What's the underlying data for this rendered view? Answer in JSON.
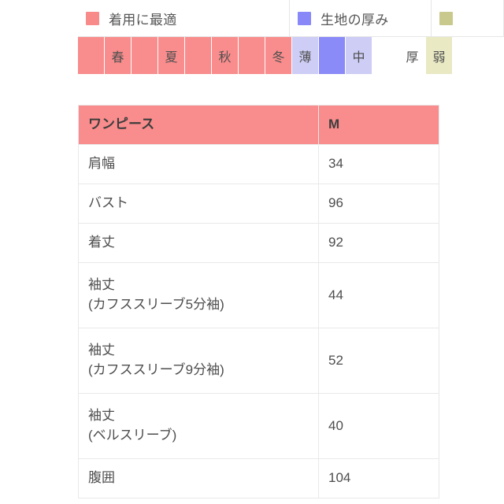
{
  "legend": {
    "items": [
      {
        "key": "season",
        "label": "着用に最適",
        "color": "#F98A8A"
      },
      {
        "key": "thick",
        "label": "生地の厚み",
        "color": "#8888F8"
      },
      {
        "key": "stretch",
        "label": "",
        "color": "#C9C98E"
      }
    ]
  },
  "scale": {
    "cells": [
      {
        "label": "",
        "color": "#F98C8C",
        "group": "season"
      },
      {
        "label": "春",
        "color": "#F98C8C",
        "group": "season"
      },
      {
        "label": "",
        "color": "#F98C8C",
        "group": "season"
      },
      {
        "label": "夏",
        "color": "#F98C8C",
        "group": "season"
      },
      {
        "label": "",
        "color": "#F98C8C",
        "group": "season"
      },
      {
        "label": "秋",
        "color": "#F98C8C",
        "group": "season"
      },
      {
        "label": "",
        "color": "#F98C8C",
        "group": "season"
      },
      {
        "label": "冬",
        "color": "#F98C8C",
        "group": "season"
      },
      {
        "label": "薄",
        "color": "#CDCDF6",
        "group": "thick"
      },
      {
        "label": "",
        "color": "#8A8AF8",
        "group": "thick"
      },
      {
        "label": "中",
        "color": "#CDCDF6",
        "group": "thick"
      },
      {
        "label": "",
        "color": "#FFFFFF",
        "group": "thick"
      },
      {
        "label": "厚",
        "color": "#FFFFFF",
        "group": "thick"
      },
      {
        "label": "弱",
        "color": "#E9E9C4",
        "group": "stretch"
      }
    ]
  },
  "table": {
    "headers": [
      "ワンピース",
      "M"
    ],
    "rows": [
      {
        "name": "肩幅",
        "sub": "",
        "value": "34"
      },
      {
        "name": "バスト",
        "sub": "",
        "value": "96"
      },
      {
        "name": "着丈",
        "sub": "",
        "value": "92"
      },
      {
        "name": "袖丈",
        "sub": "(カフススリーブ5分袖)",
        "value": "44"
      },
      {
        "name": "袖丈",
        "sub": "(カフススリーブ9分袖)",
        "value": "52"
      },
      {
        "name": "袖丈",
        "sub": "(ベルスリーブ)",
        "value": "40"
      },
      {
        "name": "腹囲",
        "sub": "",
        "value": "104"
      }
    ]
  }
}
